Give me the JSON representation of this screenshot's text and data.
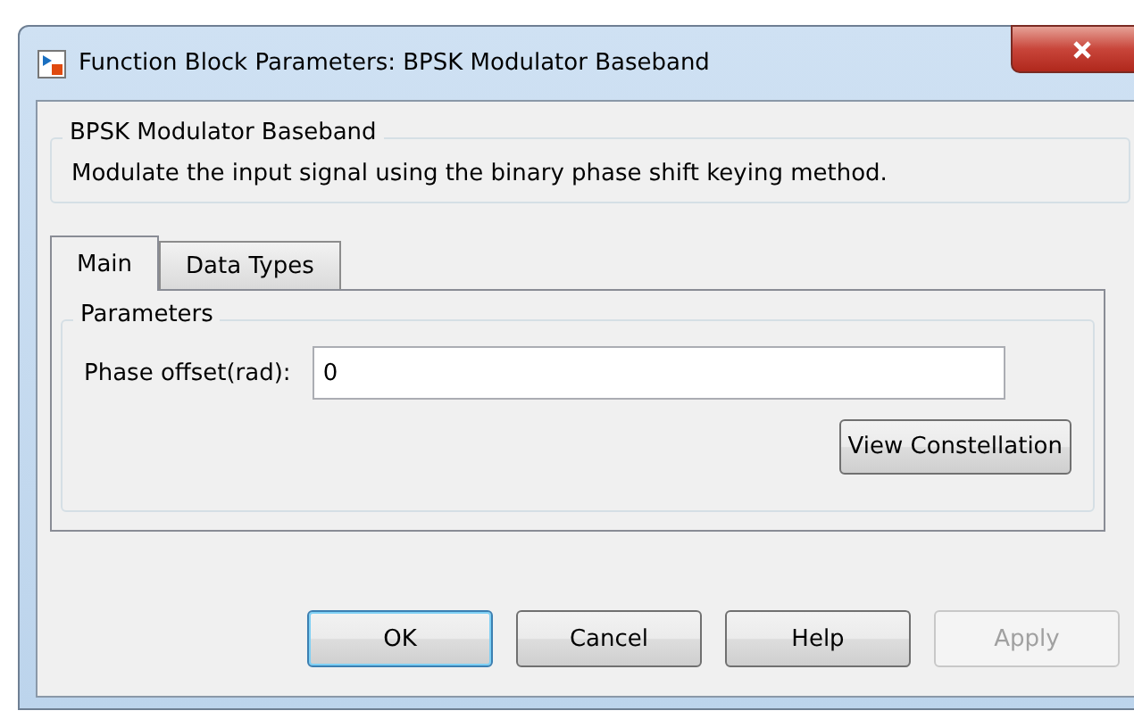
{
  "window": {
    "title": "Function Block Parameters: BPSK Modulator Baseband"
  },
  "description_group": {
    "title": "BPSK Modulator Baseband",
    "text": "Modulate the input signal using the binary phase shift keying method."
  },
  "tabs": [
    {
      "label": "Main",
      "selected": true
    },
    {
      "label": "Data Types",
      "selected": false
    }
  ],
  "parameters_group": {
    "title": "Parameters",
    "fields": [
      {
        "label": "Phase offset(rad):",
        "value": "0"
      }
    ],
    "button": {
      "label": "View Constellation",
      "disabled": false
    }
  },
  "buttons": [
    {
      "label": "OK",
      "default": true,
      "disabled": false
    },
    {
      "label": "Cancel",
      "default": false,
      "disabled": false
    },
    {
      "label": "Help",
      "default": false,
      "disabled": false
    },
    {
      "label": "Apply",
      "default": false,
      "disabled": true
    }
  ]
}
